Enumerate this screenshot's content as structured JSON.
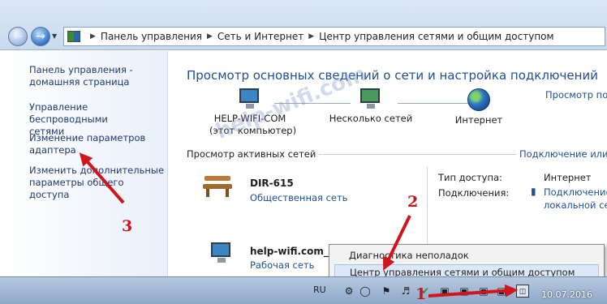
{
  "address_bar": {
    "crumbs": [
      "Панель управления",
      "Сеть и Интернет",
      "Центр управления сетями и общим доступом"
    ]
  },
  "sidebar": {
    "items": [
      {
        "line1": "Панель управления -",
        "line2": "домашняя страница"
      },
      {
        "line1": "Управление беспроводными",
        "line2": "сетями"
      },
      {
        "line1": "Изменение параметров",
        "line2": "адаптера"
      },
      {
        "line1": "Изменить дополнительные",
        "line2": "параметры общего доступа"
      }
    ]
  },
  "main": {
    "title": "Просмотр основных сведений о сети и настройка подключений",
    "map_link": "Просмотр полной карты",
    "nodes": {
      "computer": {
        "line1": "HELP-WIFI-COM",
        "line2": "(этот компьютер)"
      },
      "networks": {
        "label": "Несколько сетей"
      },
      "internet": {
        "label": "Интернет"
      }
    },
    "active_section": {
      "label": "Просмотр активных сетей",
      "link": "Подключение или отключение"
    },
    "networks": [
      {
        "name": "DIR-615",
        "type": "Общественная сеть",
        "access_label": "Тип доступа:",
        "access_value": "Интернет",
        "conn_label": "Подключения:",
        "conn_value_1": "Подключение по",
        "conn_value_2": "локальной сети"
      },
      {
        "name": "help-wifi.com_home",
        "type": "Рабочая сеть"
      }
    ]
  },
  "context_menu": {
    "items": [
      "Диагностика неполадок",
      "Центр управления сетями и общим доступом"
    ]
  },
  "taskbar": {
    "lang": "RU",
    "date": "10.07.2016"
  },
  "watermark": "help-wifi.com",
  "annotations": {
    "step1": "1",
    "step2": "2",
    "step3": "3",
    "color": "#d0161c"
  }
}
